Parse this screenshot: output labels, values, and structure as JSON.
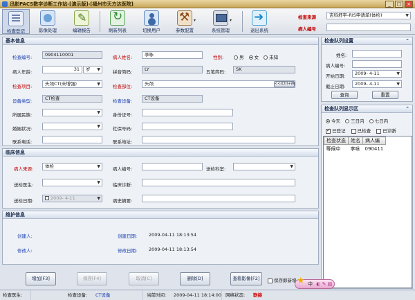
{
  "window": {
    "title": "迅影PACS数字诊断工作站-[演示版]-[福州市天方达医院]"
  },
  "toolbar": {
    "items": [
      {
        "label": "检查登记",
        "icon": "document-icon"
      },
      {
        "label": "影像处理",
        "icon": "image-icon"
      },
      {
        "label": "编辑报告",
        "icon": "edit-report-icon"
      },
      {
        "label": "刷新列表",
        "icon": "refresh-icon"
      },
      {
        "label": "切换用户",
        "icon": "user-icon"
      },
      {
        "label": "参数配置",
        "icon": "tools-icon"
      },
      {
        "label": "系统管理",
        "icon": "system-icon"
      },
      {
        "label": "退出系统",
        "icon": "exit-arrow-icon"
      }
    ],
    "source_label": "检查来源",
    "source_value": "吉科舒宇-RIS申请单(体检)",
    "patient_no_label": "病人编号"
  },
  "basic": {
    "header": "基本信息",
    "exam_no_label": "检查编号:",
    "exam_no": "0904110001",
    "name_label": "病人姓名:",
    "name": "李咏",
    "gender_label": "性别:",
    "gender_options": [
      "男",
      "女",
      "未知"
    ],
    "gender_selected": "女",
    "age_label": "病人年龄:",
    "age": "31",
    "age_unit": "岁",
    "pinyin_label": "拼音简码:",
    "pinyin": "LY",
    "wubi_label": "五笔简码:",
    "wubi": "SK",
    "item_label": "检查项目:",
    "item": "头颅CT(未增强)",
    "part_label": "检查部位:",
    "part": "头颅",
    "part_btn": "<<(Ctrl+W)",
    "device_type_label": "设备类型:",
    "device_type": "CT检查",
    "device_label": "检查设备:",
    "device": "CT设备",
    "nation_label": "所属民族:",
    "id_label": "身份证号:",
    "marital_label": "婚姻状况:",
    "social_label": "社保号码:",
    "phone_label": "联系电话:",
    "address_label": "联系地址:"
  },
  "clinical": {
    "header": "临床信息",
    "source_label": "病人来源:",
    "source": "体检",
    "patient_no_label": "病人编号:",
    "dept_label": "送检科室:",
    "doctor_label": "送检医生:",
    "diag_label": "临床诊断:",
    "date_label": "送检日期:",
    "date": "2009- 4-11",
    "summary_label": "病史摘要:"
  },
  "maintain": {
    "header": "维护信息",
    "creator_label": "创建人:",
    "created_date_label": "创建日期:",
    "created_date": "2009-04-11 18:13:54",
    "modifier_label": "修改人:",
    "modified_date_label": "修改日期:",
    "modified_date": "2009-04-11 18:13:54"
  },
  "actions": {
    "add": "增加[F3]",
    "save": "保存[F4]",
    "cancel": "取消[C]",
    "delete": "删除[D]",
    "view": "查看影像[F2]",
    "save_new": "保存即新增"
  },
  "queue_settings": {
    "header": "检查队列设置",
    "name_label": "姓名:",
    "patient_no_label": "病人编号:",
    "start_label": "开始日期:",
    "start": "2009- 4-11",
    "end_label": "截止日期:",
    "end": "2009- 4-11",
    "query": "查询",
    "reset": "重置"
  },
  "queue_display": {
    "header": "检查队列显示区",
    "range_options": [
      "今天",
      "三日内",
      "七日内"
    ],
    "range_selected": "今天",
    "filters": [
      {
        "label": "已登记",
        "checked": true
      },
      {
        "label": "已检查",
        "checked": false
      },
      {
        "label": "已诊断",
        "checked": false
      }
    ],
    "columns": [
      "检查状态",
      "姓名",
      "病人编"
    ],
    "rows": [
      [
        "等候中",
        "李咏",
        "090411"
      ]
    ]
  },
  "status": {
    "doctor_label": "检查医生:",
    "device_label": "检查设备:",
    "device": "CT设备",
    "time_label": "当前时间:",
    "time": "2009-04-11 18:14:00",
    "network_label": "网络状态:",
    "network": "联接"
  },
  "ime": {
    "label": "中"
  },
  "colors": {
    "accent_red": "#c00000",
    "label_blue": "#1a3fb0",
    "status_red": "#d00000"
  }
}
